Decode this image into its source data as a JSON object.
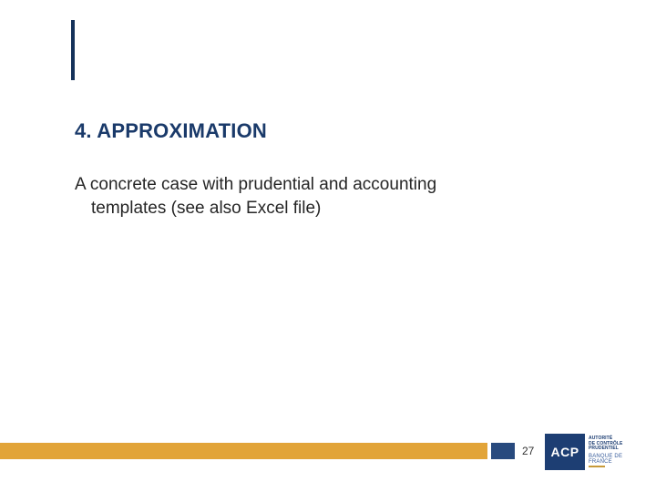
{
  "heading": "4. APPROXIMATION",
  "body": {
    "line1": "A concrete case with prudential and accounting",
    "line2": "templates (see also Excel file)"
  },
  "footer": {
    "page_number": "27"
  },
  "logo": {
    "acronym": "ACP",
    "line1": "AUTORITÉ",
    "line2": "DE CONTRÔLE",
    "line3": "PRUDENTIEL",
    "subbrand": "BANQUE DE FRANCE"
  },
  "colors": {
    "heading_blue": "#1a3a6a",
    "bar_gold": "#e2a438",
    "bar_blue": "#284a7e",
    "logo_blue": "#1d3e73"
  }
}
